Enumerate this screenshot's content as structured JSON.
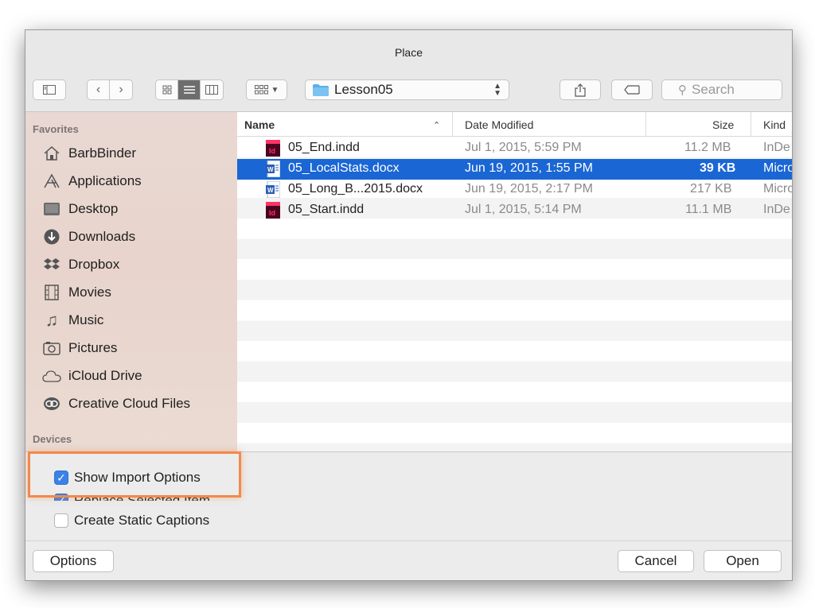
{
  "window": {
    "title": "Place"
  },
  "toolbar": {
    "location": "Lesson05",
    "search_placeholder": "Search"
  },
  "sidebar": {
    "favorites_label": "Favorites",
    "devices_label": "Devices",
    "items": [
      {
        "label": "BarbBinder",
        "icon": "home-icon"
      },
      {
        "label": "Applications",
        "icon": "applications-icon"
      },
      {
        "label": "Desktop",
        "icon": "desktop-icon"
      },
      {
        "label": "Downloads",
        "icon": "downloads-icon"
      },
      {
        "label": "Dropbox",
        "icon": "dropbox-icon"
      },
      {
        "label": "Movies",
        "icon": "movies-icon"
      },
      {
        "label": "Music",
        "icon": "music-icon"
      },
      {
        "label": "Pictures",
        "icon": "pictures-icon"
      },
      {
        "label": "iCloud Drive",
        "icon": "cloud-icon"
      },
      {
        "label": "Creative Cloud Files",
        "icon": "creative-cloud-icon"
      }
    ]
  },
  "columns": {
    "name": "Name",
    "date": "Date Modified",
    "size": "Size",
    "kind": "Kind"
  },
  "files": [
    {
      "name": "05_End.indd",
      "date": "Jul 1, 2015, 5:59 PM",
      "size": "11.2 MB",
      "kind": "InDe",
      "type": "indesign",
      "selected": false
    },
    {
      "name": "05_LocalStats.docx",
      "date": "Jun 19, 2015, 1:55 PM",
      "size": "39 KB",
      "kind": "Micro",
      "type": "word",
      "selected": true
    },
    {
      "name": "05_Long_B...2015.docx",
      "date": "Jun 19, 2015, 2:17 PM",
      "size": "217 KB",
      "kind": "Micro",
      "type": "word",
      "selected": false
    },
    {
      "name": "05_Start.indd",
      "date": "Jul 1, 2015, 5:14 PM",
      "size": "11.1 MB",
      "kind": "InDe",
      "type": "indesign",
      "selected": false
    }
  ],
  "options": {
    "show_import": "Show Import Options",
    "replace_selected": "Replace Selected Item",
    "static_captions": "Create Static Captions"
  },
  "footer": {
    "options": "Options",
    "cancel": "Cancel",
    "open": "Open"
  },
  "colors": {
    "accent": "#1a66d4",
    "highlight": "#ef8a4d",
    "checkbox": "#3b82e6"
  }
}
